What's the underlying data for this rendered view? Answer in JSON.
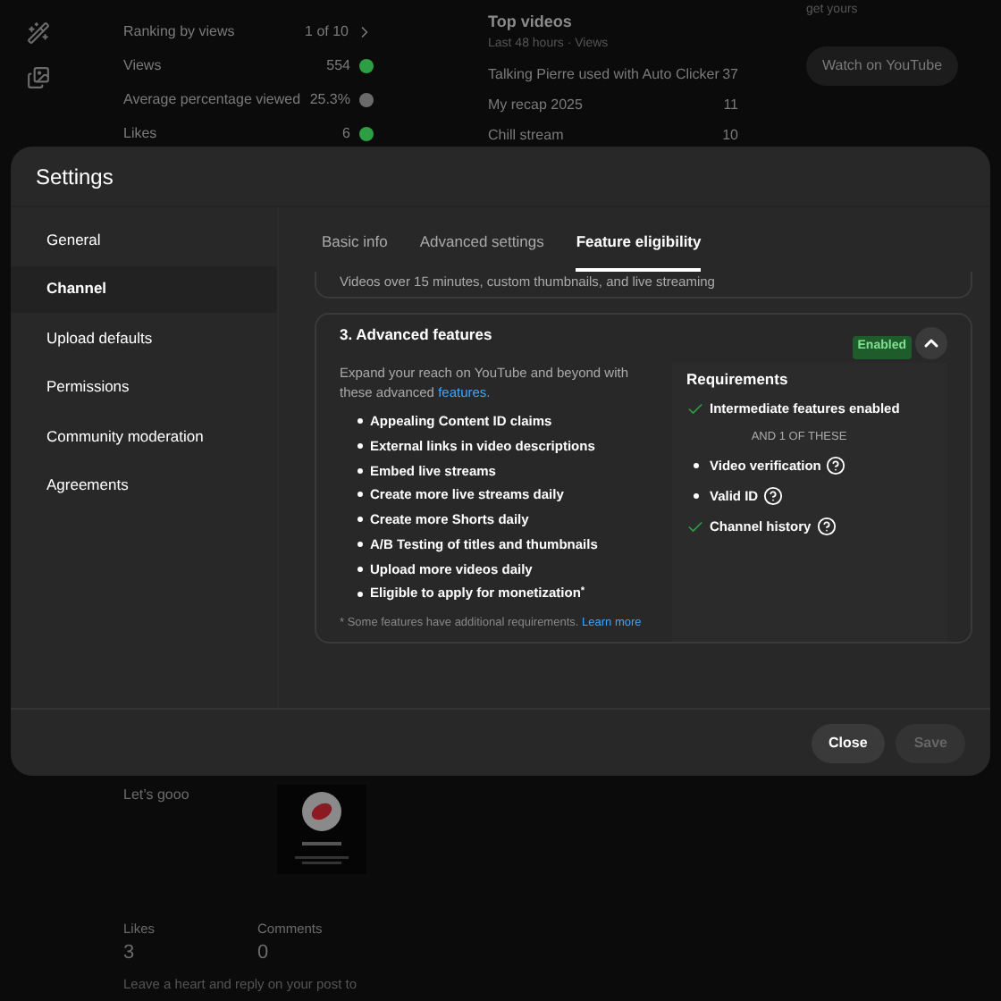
{
  "background": {
    "stats": [
      {
        "label": "Ranking by views",
        "value": "1 of 10",
        "kind": "link"
      },
      {
        "label": "Views",
        "value": "554",
        "kind": "dot",
        "color": "#2e9e44"
      },
      {
        "label": "Average percentage viewed",
        "value": "25.3%",
        "kind": "dot",
        "color": "#6b6b6b"
      },
      {
        "label": "Likes",
        "value": "6",
        "kind": "dot",
        "color": "#2e9e44"
      }
    ],
    "top_videos": {
      "title": "Top videos",
      "subtitle": "Last 48 hours · Views",
      "rows": [
        {
          "title": "Talking Pierre used with Auto Clicker",
          "views": "37"
        },
        {
          "title": "My recap 2025",
          "views": "11"
        },
        {
          "title": "Chill stream",
          "views": "10"
        }
      ]
    },
    "promo": {
      "text": "get yours",
      "button": "Watch on YouTube"
    },
    "post": {
      "text": "Let’s gooo",
      "likes_label": "Likes",
      "likes": "3",
      "comments_label": "Comments",
      "comments": "0",
      "footer_text": "Leave a heart and reply on your post to"
    }
  },
  "dialog": {
    "title": "Settings",
    "nav": [
      {
        "label": "General",
        "selected": false
      },
      {
        "label": "Channel",
        "selected": true
      },
      {
        "label": "Upload defaults",
        "selected": false
      },
      {
        "label": "Permissions",
        "selected": false
      },
      {
        "label": "Community moderation",
        "selected": false
      },
      {
        "label": "Agreements",
        "selected": false
      }
    ],
    "tabs": [
      {
        "label": "Basic info",
        "selected": false
      },
      {
        "label": "Advanced settings",
        "selected": false
      },
      {
        "label": "Feature eligibility",
        "selected": true
      }
    ],
    "previous_card": {
      "description": "Videos over 15 minutes, custom thumbnails, and live streaming"
    },
    "card": {
      "title": "3. Advanced features",
      "badge": "Enabled",
      "expanded": true,
      "intro": "Expand your reach on YouTube and beyond with these advanced",
      "intro_link": "features.",
      "features": [
        "Appealing Content ID claims",
        "External links in video descriptions",
        "Embed live streams",
        "Create more live streams daily",
        "Create more Shorts daily",
        "A/B Testing of titles and thumbnails",
        "Upload more videos daily",
        "Eligible to apply for monetization$^{*}$"
      ],
      "note": "* Some features have additional requirements.",
      "note_link": "Learn more",
      "requirements": {
        "title": "Requirements",
        "items": [
          {
            "kind": "check",
            "label": "Intermediate features enabled",
            "help": false
          },
          {
            "kind": "separator",
            "label": "AND 1 OF THESE"
          },
          {
            "kind": "bullet",
            "label": "Video verification",
            "help": true
          },
          {
            "kind": "bullet",
            "label": "Valid ID",
            "help": true
          },
          {
            "kind": "check",
            "label": "Channel history",
            "help": true
          }
        ]
      }
    },
    "buttons": [
      {
        "label": "Close",
        "disabled": false
      },
      {
        "label": "Save",
        "disabled": true
      }
    ]
  }
}
